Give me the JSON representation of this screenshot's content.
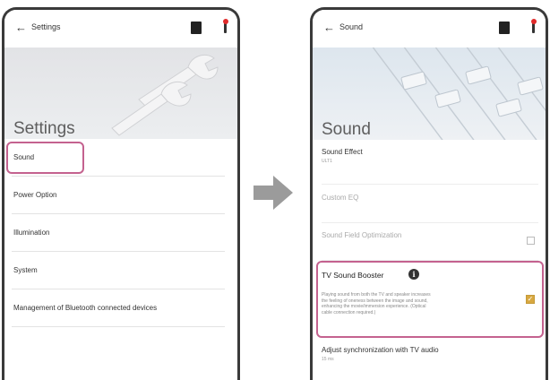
{
  "left_screen": {
    "topbar": {
      "back_icon": "arrow-left-icon",
      "title": "Settings"
    },
    "hero_title": "Settings",
    "items": [
      {
        "label": "Sound",
        "highlighted": true
      },
      {
        "label": "Power Option"
      },
      {
        "label": "Illumination"
      },
      {
        "label": "System"
      },
      {
        "label": "Management of Bluetooth connected devices"
      }
    ]
  },
  "right_screen": {
    "topbar": {
      "back_icon": "arrow-left-icon",
      "title": "Sound"
    },
    "hero_title": "Sound",
    "sound_effect": {
      "label": "Sound Effect",
      "value": "ULT1"
    },
    "custom_eq": {
      "label": "Custom EQ",
      "disabled": true
    },
    "sound_field_optimization": {
      "label": "Sound Field Optimization",
      "disabled": true,
      "checked": false
    },
    "tv_sound_booster": {
      "label": "TV Sound Booster",
      "description_lines": [
        "Playing sound from both the TV and speaker increases",
        "the feeling of oneness between the image and sound,",
        "enhancing the movie/immersion experience. (Optical",
        "cable connection required.)"
      ],
      "checked": true,
      "highlighted": true
    },
    "sync": {
      "label": "Adjust synchronization with TV audio",
      "value": "15 ms"
    }
  },
  "colors": {
    "highlight": "#c4628f",
    "checkbox_checked": "#d8a840",
    "arrow": "#9b9b9b",
    "badge_red": "#e12b2b"
  }
}
